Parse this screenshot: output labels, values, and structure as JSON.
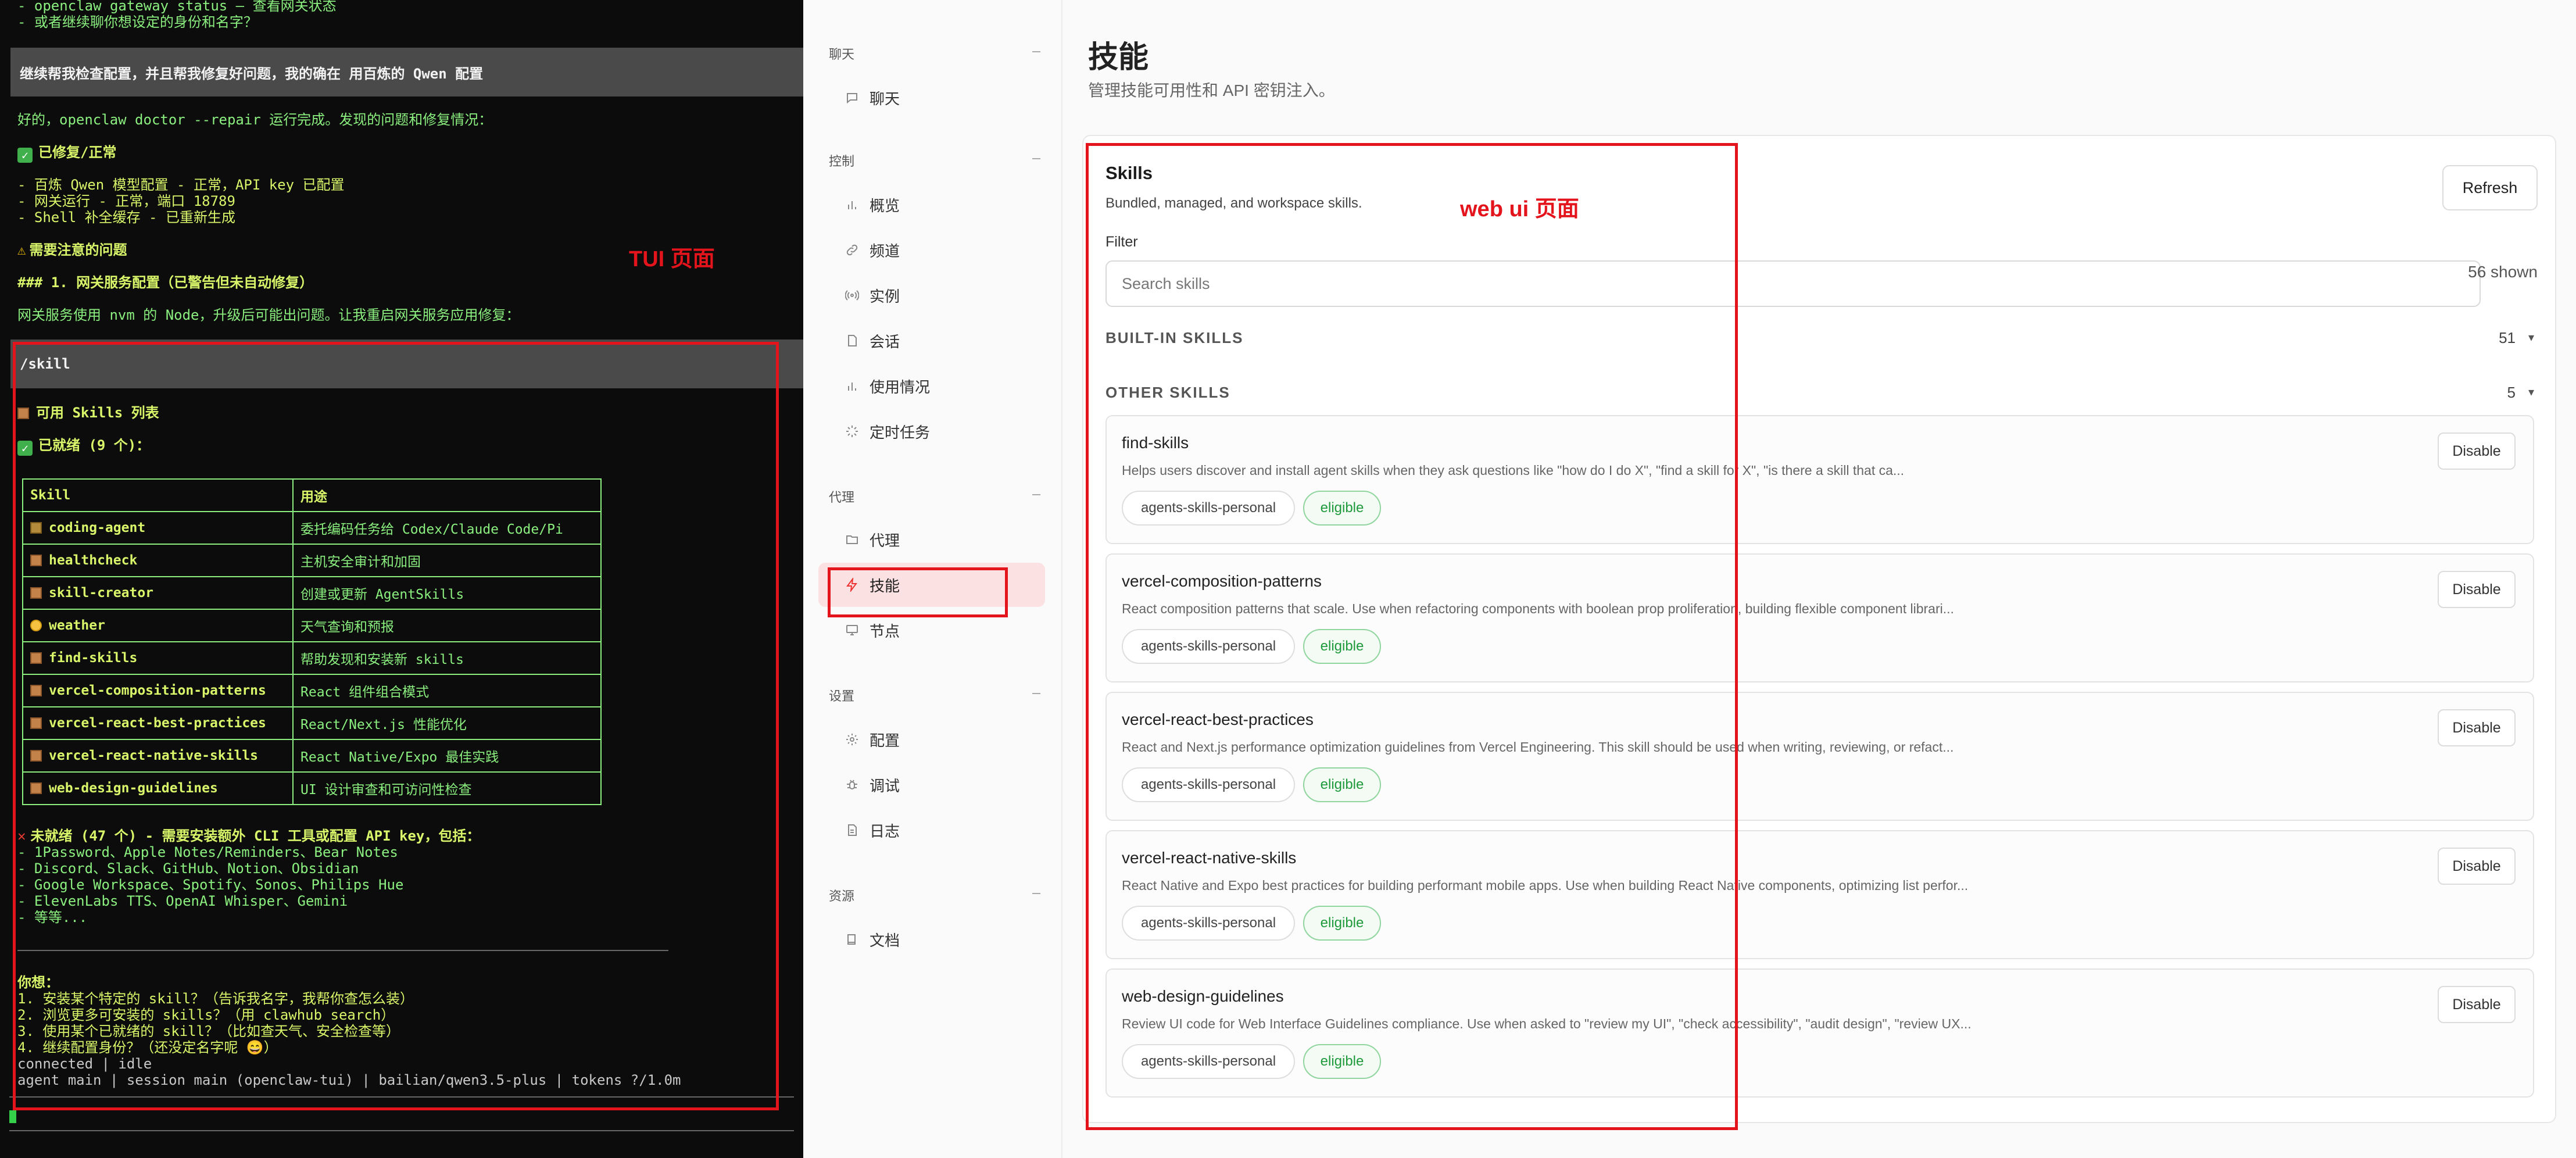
{
  "terminal": {
    "lines_top": [
      "- openclaw gateway status — 查看网关状态",
      "- 或者继续聊你想设定的身份和名字？"
    ],
    "user_msg_1": "继续帮我检查配置，并且帮我修复好问题，我的确在 用百炼的 Qwen 配置",
    "doctor_line": "好的，openclaw doctor --repair 运行完成。发现的问题和修复情况：",
    "fixed_heading": "已修复/正常",
    "fixed_items": [
      "- 百炼 Qwen 模型配置 - 正常，API key 已配置",
      "- 网关运行 - 正常，端口 18789",
      "- Shell 补全缓存 - 已重新生成"
    ],
    "attention_heading": "需要注意的问题",
    "section_heading": "### 1. 网关服务配置（已警告但未自动修复）",
    "nvm_line": "网关服务使用 nvm 的 Node，升级后可能出问题。让我重启网关服务应用修复：",
    "user_msg_2": "/skill",
    "skills_heading": "可用 Skills 列表",
    "ready_heading": "已就绪 (9 个)：",
    "table_headers": [
      "Skill",
      "用途"
    ],
    "table_rows": [
      {
        "skill": "coding-agent",
        "desc": "委托编码任务给 Codex/Claude Code/Pi",
        "icon": "puzzle"
      },
      {
        "skill": "healthcheck",
        "desc": "主机安全审计和加固",
        "icon": "package"
      },
      {
        "skill": "skill-creator",
        "desc": "创建或更新 AgentSkills",
        "icon": "package"
      },
      {
        "skill": "weather",
        "desc": "天气查询和预报",
        "icon": "sun"
      },
      {
        "skill": "find-skills",
        "desc": "帮助发现和安装新 skills",
        "icon": "package"
      },
      {
        "skill": "vercel-composition-patterns",
        "desc": "React 组件组合模式",
        "icon": "package"
      },
      {
        "skill": "vercel-react-best-practices",
        "desc": "React/Next.js 性能优化",
        "icon": "package"
      },
      {
        "skill": "vercel-react-native-skills",
        "desc": "React Native/Expo 最佳实践",
        "icon": "package"
      },
      {
        "skill": "web-design-guidelines",
        "desc": "UI 设计审查和可访问性检查",
        "icon": "package"
      }
    ],
    "not_ready_heading": "未就绪 (47 个) - 需要安装额外 CLI 工具或配置 API key，包括：",
    "not_ready_items": [
      "- 1Password、Apple Notes/Reminders、Bear Notes",
      "- Discord、Slack、GitHub、Notion、Obsidian",
      "- Google Workspace、Spotify、Sonos、Philips Hue",
      "- ElevenLabs TTS、OpenAI Whisper、Gemini",
      "- 等等..."
    ],
    "want_heading": "你想：",
    "want_items": [
      "1. 安装某个特定的 skill？（告诉我名字，我帮你查怎么装）",
      "2. 浏览更多可安装的 skills？（用 clawhub search）",
      "3. 使用某个已就绪的 skill？（比如查天气、安全检查等）",
      "4. 继续配置身份？（还没定名字呢 😄）"
    ],
    "status_connected": "connected | idle",
    "status_session": "agent main | session main (openclaw-tui) | bailian/qwen3.5-plus | tokens ?/1.0m"
  },
  "annotations": {
    "tui_label": "TUI 页面",
    "webui_label": "web ui 页面",
    "color": "#e3141c"
  },
  "sidebar": {
    "groups": [
      {
        "label": "聊天",
        "items": [
          {
            "label": "聊天",
            "icon": "chat-icon"
          }
        ]
      },
      {
        "label": "控制",
        "items": [
          {
            "label": "概览",
            "icon": "bar-chart-icon"
          },
          {
            "label": "频道",
            "icon": "link-icon"
          },
          {
            "label": "实例",
            "icon": "radio-icon"
          },
          {
            "label": "会话",
            "icon": "document-icon"
          },
          {
            "label": "使用情况",
            "icon": "bar-chart-icon"
          },
          {
            "label": "定时任务",
            "icon": "loader-icon"
          }
        ]
      },
      {
        "label": "代理",
        "items": [
          {
            "label": "代理",
            "icon": "folder-icon"
          },
          {
            "label": "技能",
            "icon": "zap-icon",
            "active": true
          },
          {
            "label": "节点",
            "icon": "monitor-icon"
          }
        ]
      },
      {
        "label": "设置",
        "items": [
          {
            "label": "配置",
            "icon": "gear-icon"
          },
          {
            "label": "调试",
            "icon": "bug-icon"
          },
          {
            "label": "日志",
            "icon": "file-icon"
          }
        ]
      },
      {
        "label": "资源",
        "items": [
          {
            "label": "文档",
            "icon": "book-icon"
          }
        ]
      }
    ],
    "accent": "#e33333"
  },
  "main": {
    "title": "技能",
    "subtitle": "管理技能可用性和 API 密钥注入。",
    "skills_title": "Skills",
    "skills_subtitle": "Bundled, managed, and workspace skills.",
    "refresh_label": "Refresh",
    "filter_label": "Filter",
    "search_placeholder": "Search skills",
    "shown_count": "56 shown",
    "builtin_label": "BUILT-IN SKILLS",
    "builtin_count": "51",
    "other_label": "OTHER SKILLS",
    "other_count": "5",
    "skills": [
      {
        "name": "find-skills",
        "desc": "Helps users discover and install agent skills when they ask questions like \"how do I do X\", \"find a skill for X\", \"is there a skill that ca...",
        "source": "agents-skills-personal",
        "status": "eligible",
        "action": "Disable"
      },
      {
        "name": "vercel-composition-patterns",
        "desc": "React composition patterns that scale. Use when refactoring components with boolean prop proliferation, building flexible component librari...",
        "source": "agents-skills-personal",
        "status": "eligible",
        "action": "Disable"
      },
      {
        "name": "vercel-react-best-practices",
        "desc": "React and Next.js performance optimization guidelines from Vercel Engineering. This skill should be used when writing, reviewing, or refact...",
        "source": "agents-skills-personal",
        "status": "eligible",
        "action": "Disable"
      },
      {
        "name": "vercel-react-native-skills",
        "desc": "React Native and Expo best practices for building performant mobile apps. Use when building React Native components, optimizing list perfor...",
        "source": "agents-skills-personal",
        "status": "eligible",
        "action": "Disable"
      },
      {
        "name": "web-design-guidelines",
        "desc": "Review UI code for Web Interface Guidelines compliance. Use when asked to \"review my UI\", \"check accessibility\", \"audit design\", \"review UX...",
        "source": "agents-skills-personal",
        "status": "eligible",
        "action": "Disable"
      }
    ]
  }
}
